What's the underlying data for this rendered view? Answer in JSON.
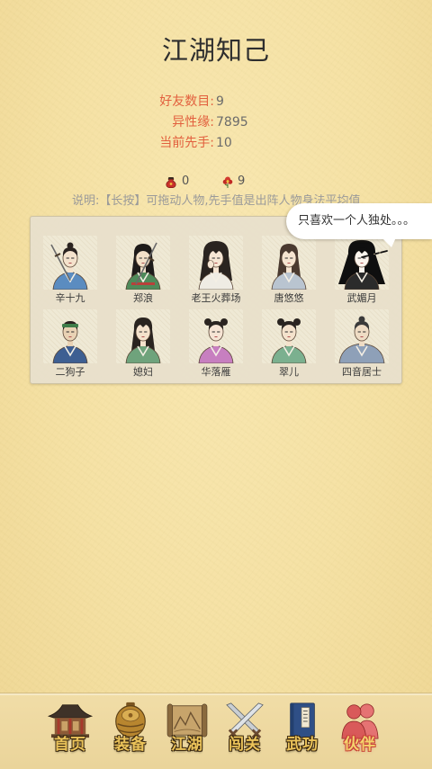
{
  "screen": {
    "title": "江湖知己"
  },
  "stats": [
    {
      "label": "好友数目:",
      "value": "9"
    },
    {
      "label": "异性缘:",
      "value": "7895"
    },
    {
      "label": "当前先手:",
      "value": "10"
    }
  ],
  "resources": [
    {
      "icon": "red-pouch-icon",
      "count": "0"
    },
    {
      "icon": "red-flower-icon",
      "count": "9"
    }
  ],
  "hint": "说明:【长按】可拖动人物,先手值是出阵人物身法平均值",
  "speech_bubble": {
    "text": "只喜欢一个人独处。。。"
  },
  "companions": [
    {
      "name": "辛十九"
    },
    {
      "name": "郑浪"
    },
    {
      "name": "老王火葬场"
    },
    {
      "name": "唐悠悠"
    },
    {
      "name": "武媚月"
    },
    {
      "name": "二狗子"
    },
    {
      "name": "媳妇"
    },
    {
      "name": "华落雁"
    },
    {
      "name": "翠儿"
    },
    {
      "name": "四音居士"
    }
  ],
  "nav": {
    "items": [
      {
        "label": "首页",
        "icon": "palace-icon"
      },
      {
        "label": "装备",
        "icon": "armor-icon"
      },
      {
        "label": "江湖",
        "icon": "map-scroll-icon"
      },
      {
        "label": "闯关",
        "icon": "crossed-swords-icon"
      },
      {
        "label": "武功",
        "icon": "martial-manual-icon"
      },
      {
        "label": "伙伴",
        "icon": "companions-icon",
        "active": true
      }
    ]
  },
  "colors": {
    "background": "#F5E1A4",
    "title": "#2E2E2E",
    "stat_label": "#E2603E",
    "stat_value": "#6B6B6B",
    "hint": "#9A9A9A",
    "nav_label": "#EBC35A",
    "active_accent": "#C8423A"
  }
}
